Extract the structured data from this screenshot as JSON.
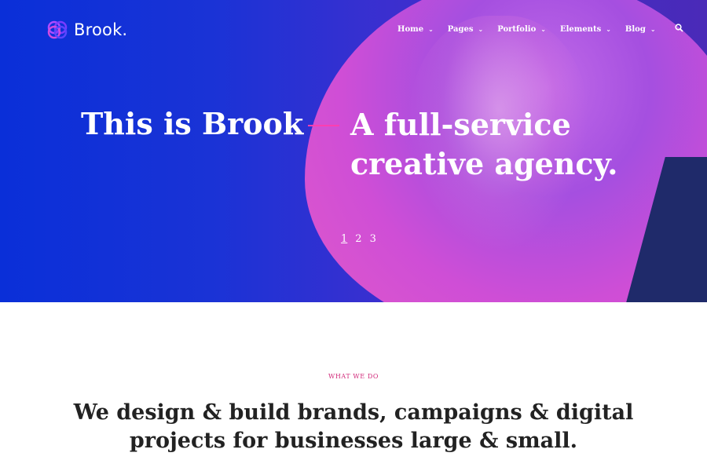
{
  "brand": {
    "name": "Brook.",
    "logo_icon": "interlocked-rings-logo-icon"
  },
  "nav": {
    "items": [
      {
        "label": "Home",
        "icon": "chevron-down-icon"
      },
      {
        "label": "Pages",
        "icon": "chevron-down-icon"
      },
      {
        "label": "Portfolio",
        "icon": "chevron-down-icon"
      },
      {
        "label": "Elements",
        "icon": "chevron-down-icon"
      },
      {
        "label": "Blog",
        "icon": "chevron-down-icon"
      }
    ],
    "search_icon": "search-icon"
  },
  "hero": {
    "title_left": "This is Brook",
    "title_right_line1": "A full-service",
    "title_right_line2": "creative agency.",
    "accent_color": "#ff3fb0",
    "slides": [
      "1",
      "2",
      "3"
    ],
    "active_slide": "1"
  },
  "section": {
    "label": "WHAT WE DO",
    "title_line1": "We design & build brands, campaigns & digital",
    "title_line2": "projects for businesses large & small.",
    "label_color": "#d12a7a"
  }
}
